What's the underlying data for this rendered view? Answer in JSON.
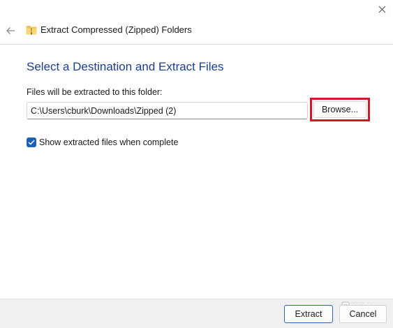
{
  "window": {
    "title": "Extract Compressed (Zipped) Folders",
    "close_icon": "close-icon",
    "back_icon": "back-arrow-icon",
    "title_icon": "zipped-folder-icon"
  },
  "main": {
    "heading": "Select a Destination and Extract Files",
    "destination_label": "Files will be extracted to this folder:",
    "destination_path": "C:\\Users\\cburk\\Downloads\\Zipped (2)",
    "browse_label": "Browse...",
    "show_files_checked": true,
    "show_files_label": "Show extracted files when complete"
  },
  "footer": {
    "extract_label": "Extract",
    "cancel_label": "Cancel"
  },
  "watermark": {
    "text": "XDA"
  },
  "colors": {
    "accent": "#1c5fb8",
    "heading": "#1c3e92",
    "highlight": "#d0192c",
    "footer_bg": "#f0f0f0"
  }
}
